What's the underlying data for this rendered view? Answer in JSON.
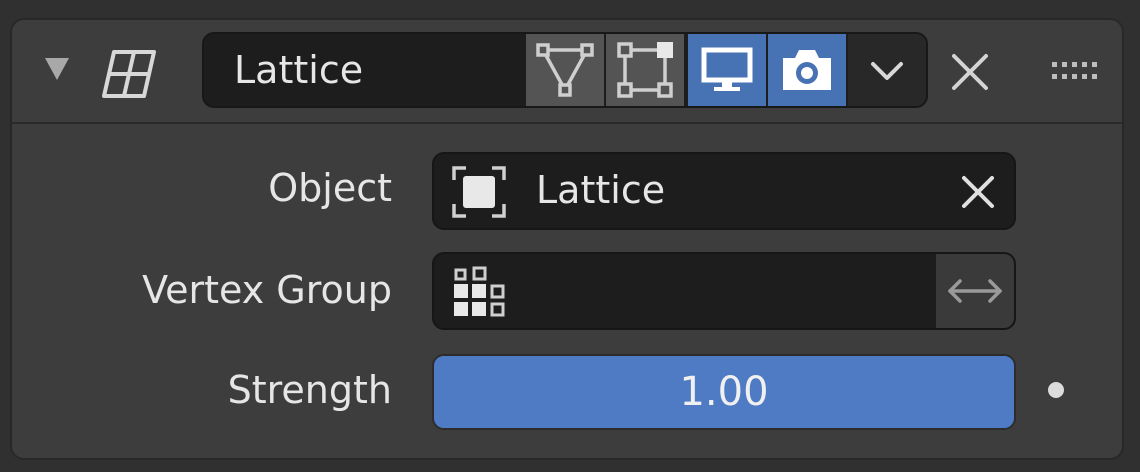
{
  "modifier": {
    "name": "Lattice",
    "toggles": [
      {
        "name": "edit-mode",
        "icon": "edit-mode-triangle-icon",
        "active": false
      },
      {
        "name": "on-cage",
        "icon": "on-cage-vertices-icon",
        "active": false
      },
      {
        "name": "viewport",
        "icon": "monitor-icon",
        "active": true
      },
      {
        "name": "render",
        "icon": "camera-icon",
        "active": true
      }
    ]
  },
  "fields": {
    "object": {
      "label": "Object",
      "value": "Lattice",
      "icon": "lattice-object-icon"
    },
    "vertex_group": {
      "label": "Vertex Group",
      "value": "",
      "icon": "vertex-group-icon"
    },
    "strength": {
      "label": "Strength",
      "value": "1.00",
      "fraction": 1.0
    }
  },
  "colors": {
    "accent": "#4772b3",
    "slider": "#4e7bc4",
    "panel": "#3d3d3d",
    "field": "#1d1d1d"
  }
}
